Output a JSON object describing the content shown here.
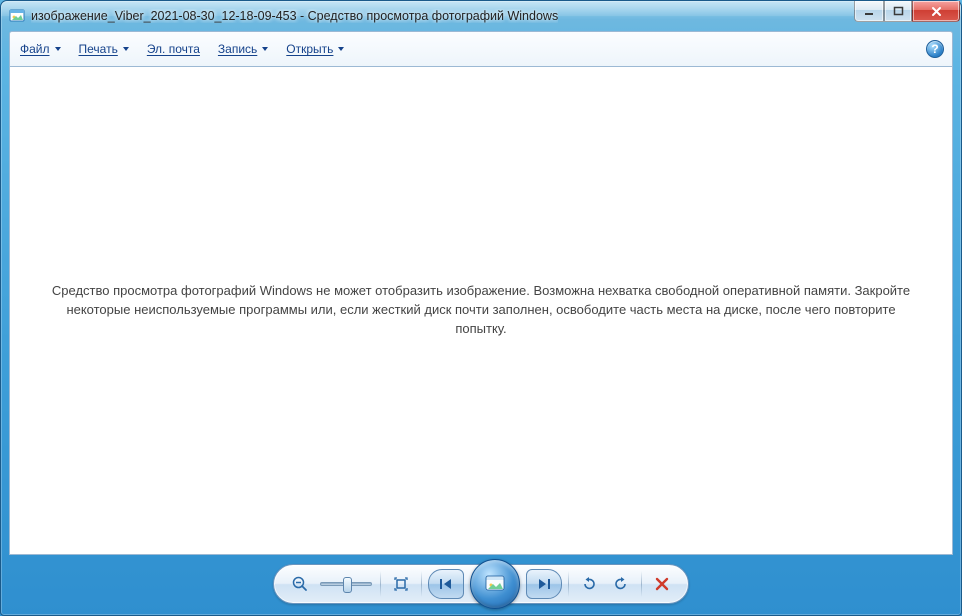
{
  "window": {
    "title": "изображение_Viber_2021-08-30_12-18-09-453 - Средство просмотра фотографий Windows"
  },
  "toolbar": {
    "file": "Файл",
    "print": "Печать",
    "email": "Эл. почта",
    "burn": "Запись",
    "open": "Открыть"
  },
  "content": {
    "error_message": "Средство просмотра фотографий Windows не может отобразить изображение. Возможна нехватка свободной оперативной памяти. Закройте некоторые неиспользуемые программы или, если жесткий диск почти заполнен, освободите часть места на диске, после чего повторите попытку."
  },
  "help": {
    "symbol": "?"
  }
}
